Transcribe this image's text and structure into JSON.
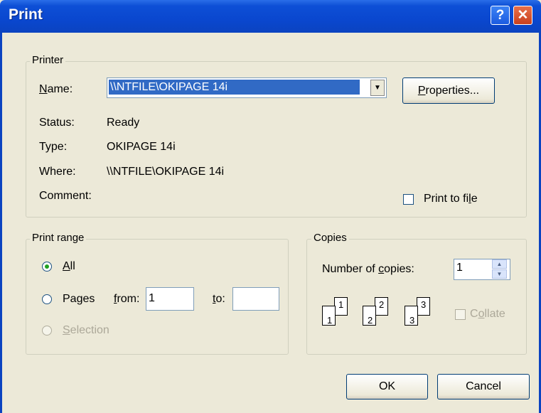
{
  "window": {
    "title": "Print",
    "help_glyph": "?",
    "close_glyph": "✕"
  },
  "printer": {
    "legend": "Printer",
    "name_label": "Name:",
    "name_value": "\\\\NTFILE\\OKIPAGE 14i",
    "properties_button": "Properties...",
    "status_label": "Status:",
    "status_value": "Ready",
    "type_label": "Type:",
    "type_value": "OKIPAGE 14i",
    "where_label": "Where:",
    "where_value": "\\\\NTFILE\\OKIPAGE 14i",
    "comment_label": "Comment:",
    "print_to_file_label": "Print to file",
    "print_to_file_checked": false
  },
  "print_range": {
    "legend": "Print range",
    "all_label": "All",
    "pages_label": "Pages",
    "from_label": "from:",
    "from_value": "1",
    "to_label": "to:",
    "to_value": "",
    "selection_label": "Selection",
    "selected": "all"
  },
  "copies": {
    "legend": "Copies",
    "number_label": "Number of copies:",
    "number_value": "1",
    "collate_label": "Collate",
    "collate_checked": false,
    "collate_enabled": false,
    "page_icon_numbers": [
      "1",
      "1",
      "2",
      "2",
      "3",
      "3"
    ]
  },
  "buttons": {
    "ok": "OK",
    "cancel": "Cancel"
  }
}
